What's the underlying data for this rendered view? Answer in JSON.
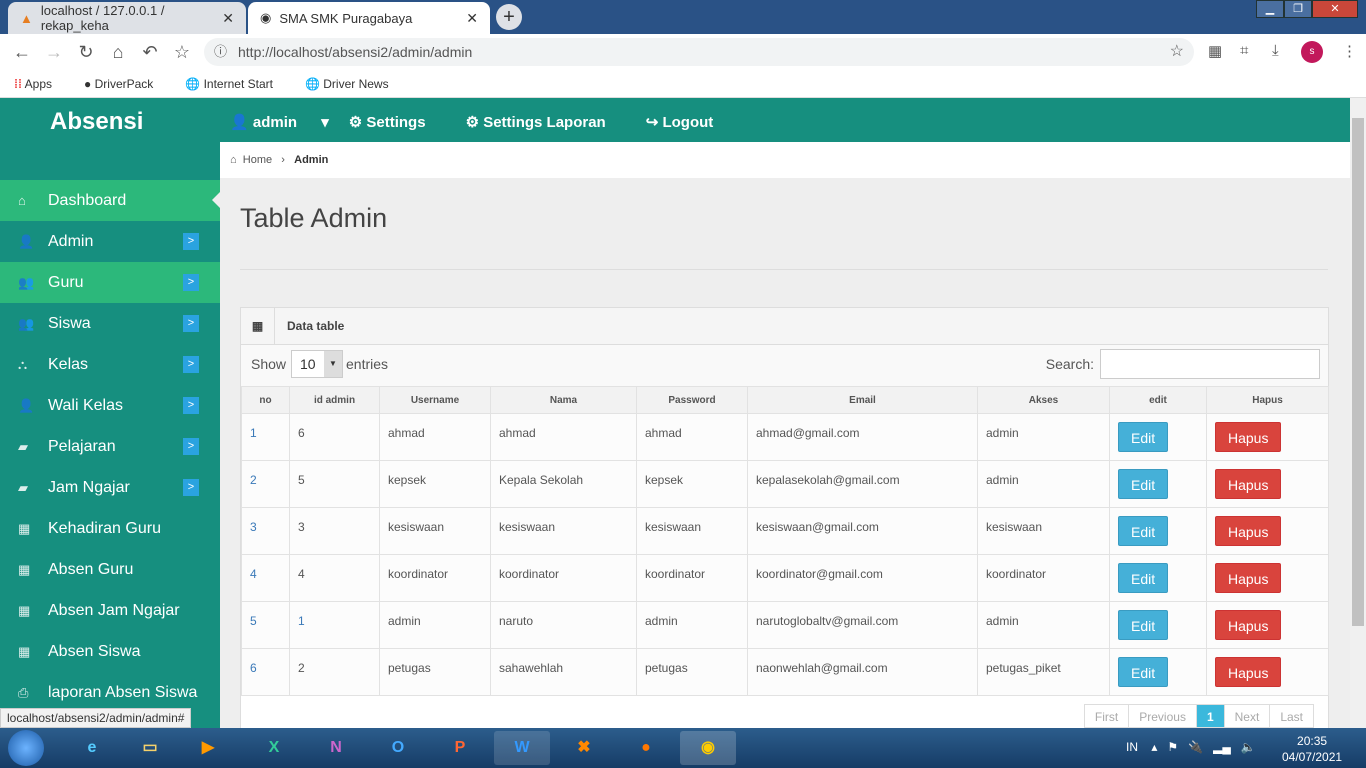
{
  "browser": {
    "tabs": [
      {
        "title": "localhost / 127.0.0.1 / rekap_keha"
      },
      {
        "title": "SMA SMK Puragabaya"
      }
    ],
    "url": "http://localhost/absensi2/admin/admin",
    "profile_initial": "s",
    "bookmarks": [
      "Apps",
      "DriverPack",
      "Internet Start",
      "Driver News"
    ],
    "status_url": "localhost/absensi2/admin/admin#"
  },
  "app": {
    "brand": "Absensi",
    "top_menu": [
      "admin",
      "Settings",
      "Settings Laporan",
      "Logout"
    ],
    "sidebar": [
      {
        "label": "Dashboard",
        "icon": "home-icon",
        "active": true
      },
      {
        "label": "Admin",
        "icon": "user-icon",
        "arrow": ">"
      },
      {
        "label": "Guru",
        "icon": "users-icon",
        "arrow": ">",
        "active": true
      },
      {
        "label": "Siswa",
        "icon": "users-icon",
        "arrow": ">"
      },
      {
        "label": "Kelas",
        "icon": "sitemap-icon",
        "arrow": ">"
      },
      {
        "label": "Wali Kelas",
        "icon": "user-icon",
        "arrow": ">"
      },
      {
        "label": "Pelajaran",
        "icon": "book-icon",
        "arrow": ">"
      },
      {
        "label": "Jam Ngajar",
        "icon": "book-icon",
        "arrow": ">"
      },
      {
        "label": "Kehadiran Guru",
        "icon": "calendar-icon"
      },
      {
        "label": "Absen Guru",
        "icon": "calendar-icon"
      },
      {
        "label": "Absen Jam Ngajar",
        "icon": "calendar-icon"
      },
      {
        "label": "Absen Siswa",
        "icon": "calendar-icon"
      },
      {
        "label": "laporan Absen Siswa",
        "icon": "print-icon"
      }
    ],
    "breadcrumb": {
      "home": "Home",
      "current": "Admin"
    },
    "page_title": "Table Admin",
    "panel_title": "Data table",
    "show": "Show",
    "entries_value": "10",
    "entries": "entries",
    "search_label": "Search:",
    "columns": [
      "no",
      "id admin",
      "Username",
      "Nama",
      "Password",
      "Email",
      "Akses",
      "edit",
      "Hapus"
    ],
    "rows": [
      [
        "1",
        "6",
        "ahmad",
        "ahmad",
        "ahmad",
        "ahmad@gmail.com",
        "admin"
      ],
      [
        "2",
        "5",
        "kepsek",
        "Kepala Sekolah",
        "kepsek",
        "kepalasekolah@gmail.com",
        "admin"
      ],
      [
        "3",
        "3",
        "kesiswaan",
        "kesiswaan",
        "kesiswaan",
        "kesiswaan@gmail.com",
        "kesiswaan"
      ],
      [
        "4",
        "4",
        "koordinator",
        "koordinator",
        "koordinator",
        "koordinator@gmail.com",
        "koordinator"
      ],
      [
        "5",
        "1",
        "admin",
        "naruto",
        "admin",
        "narutoglobaltv@gmail.com",
        "admin"
      ],
      [
        "6",
        "2",
        "petugas",
        "sahawehlah",
        "petugas",
        "naonwehlah@gmail.com",
        "petugas_piket"
      ]
    ],
    "edit_label": "Edit",
    "delete_label": "Hapus",
    "pager": [
      "First",
      "Previous",
      "1",
      "Next",
      "Last"
    ]
  },
  "taskbar": {
    "lang": "IN",
    "time": "20:35",
    "date": "04/07/2021"
  },
  "colors": {
    "teal": "#168f7f",
    "active": "#2cb87b",
    "edit": "#45b0d8",
    "hapus": "#d9443d"
  }
}
